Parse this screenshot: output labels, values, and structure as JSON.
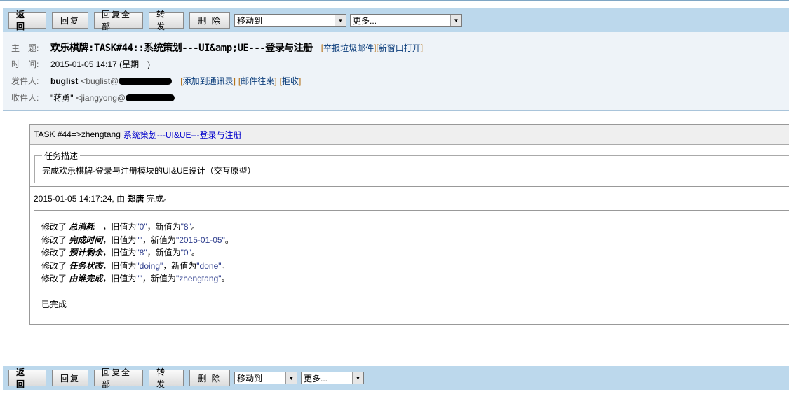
{
  "toolbar": {
    "back": "返 回",
    "reply": "回复",
    "reply_all": "回复全部",
    "forward": "转 发",
    "delete": "删 除",
    "move_to": "移动到",
    "more": "更多..."
  },
  "header": {
    "subject_label": "主　题:",
    "subject": "欢乐棋牌:TASK#44::系统策划---UI&amp;UE---登录与注册",
    "report_spam": "举报垃圾邮件",
    "open_new_window": "新窗口打开",
    "time_label": "时　间:",
    "time": "2015-01-05 14:17 (星期一)",
    "from_label": "发件人:",
    "from_name": "buglist",
    "from_addr": "<buglist@",
    "add_contact": "添加到通讯录",
    "mail_history": "邮件往来",
    "reject": "拒收",
    "to_label": "收件人:",
    "to_name": "\"蒋勇\"",
    "to_addr": "<jiangyong@"
  },
  "task": {
    "prefix": "TASK #44=>zhengtang",
    "link": "系统策划---UI&UE---登录与注册",
    "legend": "任务描述",
    "description": "完成欢乐棋牌-登录与注册模块的UI&UE设计（交互原型）",
    "completed_time": "2015-01-05 14:17:24, 由",
    "completed_by": "郑唐",
    "completed_suffix": "完成。",
    "changes": [
      {
        "prefix": "修改了",
        "field": "总消耗　",
        "mid": "，旧值为",
        "old": "\"0\"",
        "mid2": "，新值为",
        "new": "\"8\"",
        "end": "。"
      },
      {
        "prefix": "修改了",
        "field": "完成时间",
        "mid": "，旧值为",
        "old": "\"\"",
        "mid2": "，新值为",
        "new": "\"2015-01-05\"",
        "end": "。"
      },
      {
        "prefix": "修改了",
        "field": "预计剩余",
        "mid": "，旧值为",
        "old": "\"8\"",
        "mid2": "，新值为",
        "new": "\"0\"",
        "end": "。"
      },
      {
        "prefix": "修改了",
        "field": "任务状态",
        "mid": "，旧值为",
        "old": "\"doing\"",
        "mid2": "，新值为",
        "new": "\"done\"",
        "end": "。"
      },
      {
        "prefix": "修改了",
        "field": "由谁完成",
        "mid": "，旧值为",
        "old": "\"\"",
        "mid2": "，新值为",
        "new": "\"zhengtang\"",
        "end": "。"
      }
    ],
    "comment": "已完成"
  }
}
